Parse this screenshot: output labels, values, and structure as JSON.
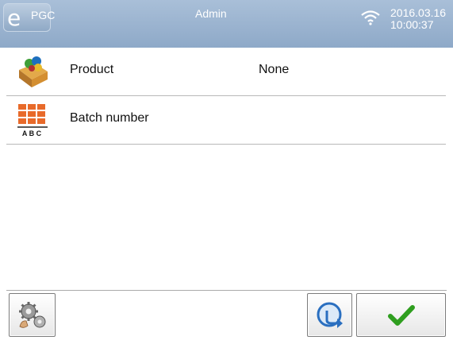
{
  "header": {
    "app_name": "PGC",
    "user": "Admin",
    "date": "2016.03.16",
    "time": "10:00:37"
  },
  "rows": [
    {
      "label": "Product",
      "value": "None",
      "icon": "product-box-icon"
    },
    {
      "label": "Batch number",
      "value": "",
      "icon": "batch-abc-icon"
    }
  ],
  "batch_icon_text": "A B C",
  "footer": {
    "left_button_icon": "settings-gears-icon",
    "exit_button_icon": "exit-arrow-icon",
    "ok_button_icon": "checkmark-icon"
  },
  "colors": {
    "header_top": "#a9bfd8",
    "header_bottom": "#8ea9c8",
    "check_green": "#2f9e1f",
    "batch_orange": "#e86a2a"
  }
}
